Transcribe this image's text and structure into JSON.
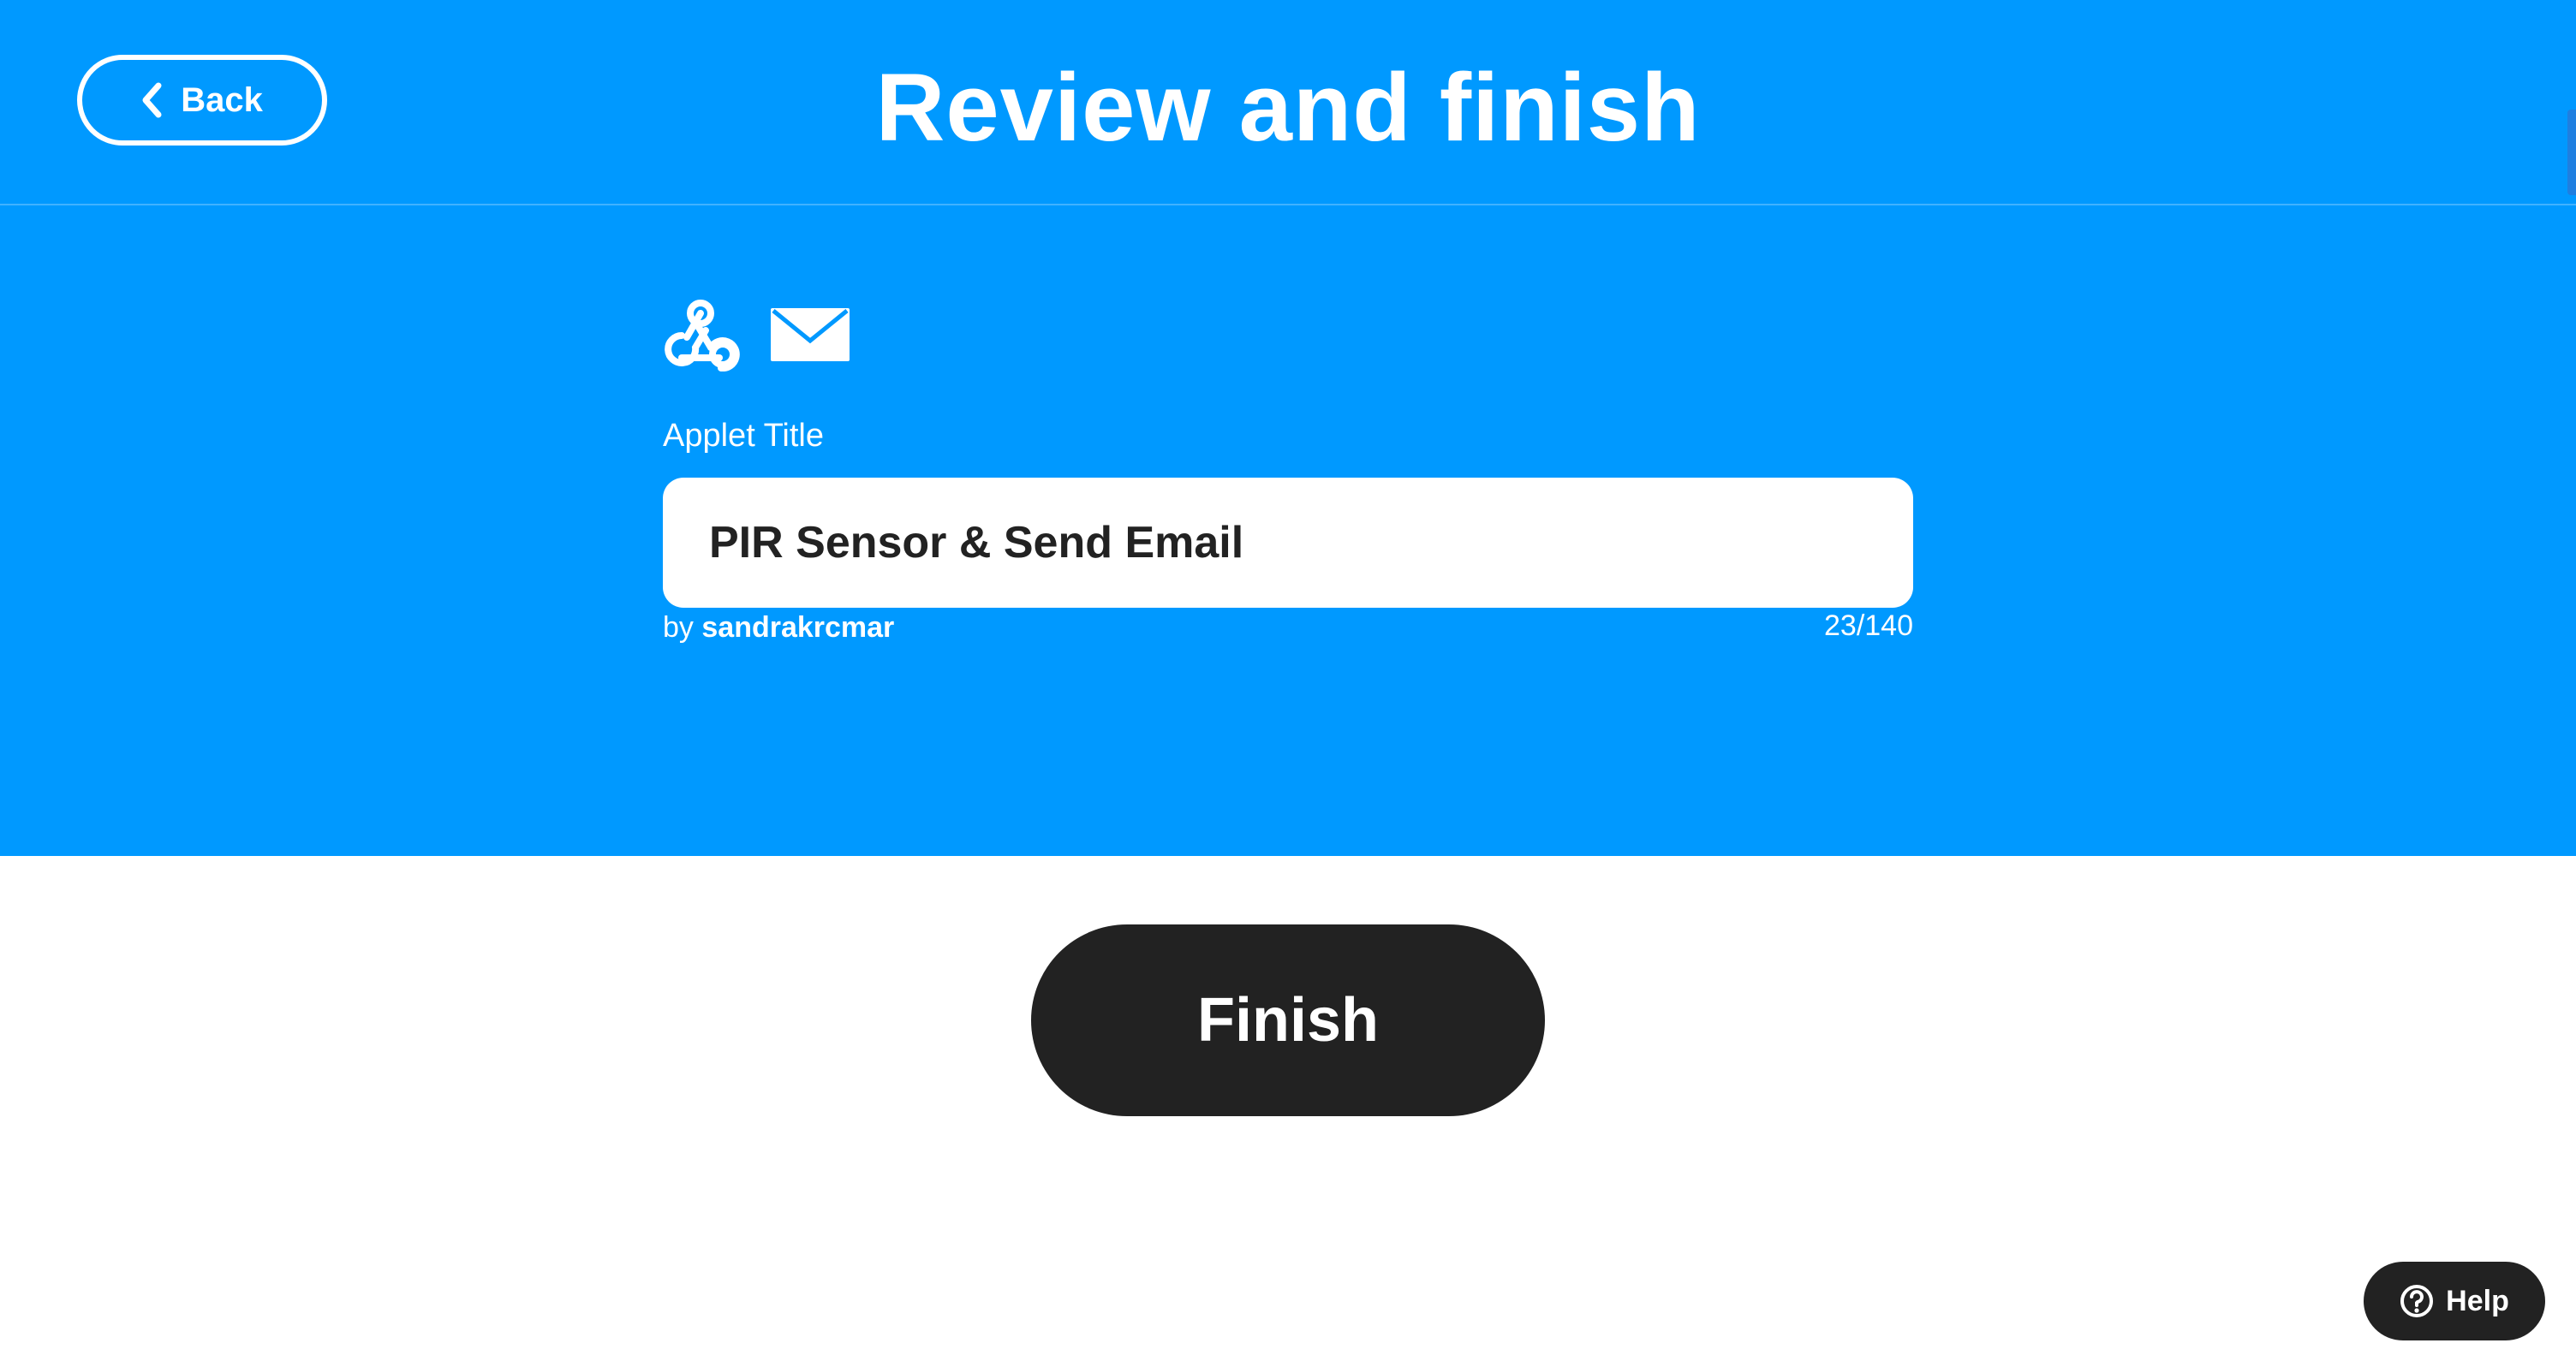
{
  "header": {
    "back_label": "Back",
    "title": "Review and finish",
    "back_icon": "chevron-left-icon",
    "background_color": "#0099ff"
  },
  "applet": {
    "service_icons": [
      "webhooks-icon",
      "email-icon"
    ],
    "field_label": "Applet Title",
    "title_value": "PIR Sensor & Send Email",
    "byline_prefix": "by",
    "author": "sandrakrcmar",
    "char_count": "23/140"
  },
  "actions": {
    "finish_label": "Finish",
    "finish_color": "#222222"
  },
  "help": {
    "label": "Help",
    "icon": "help-circle-icon"
  }
}
